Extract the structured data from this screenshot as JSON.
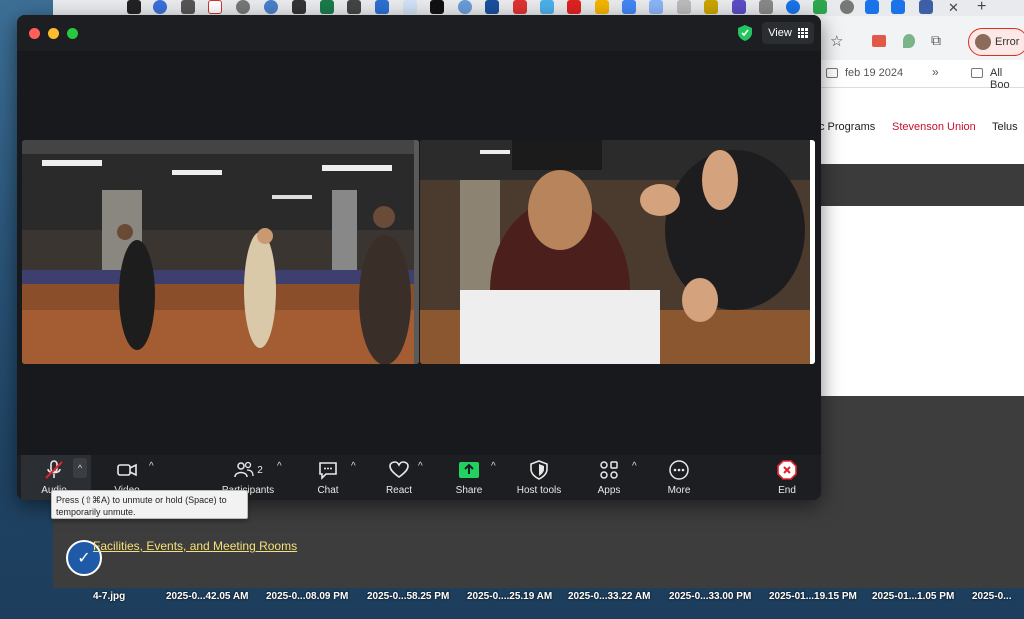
{
  "browser": {
    "bookmarks": {
      "folder_1": "feb 19 2024",
      "folder_2": "All Boo"
    },
    "profile_label": "Error",
    "site_nav": {
      "item_1": "c Programs",
      "item_2": "Stevenson Union",
      "item_3": "Telus"
    },
    "footer_link": "Facilities, Events, and Meeting Rooms",
    "colors": {
      "nav_red": "#c8102e",
      "link_yellow": "#f5e07a"
    }
  },
  "zoom": {
    "view_label": "View",
    "toolbar": {
      "audio": "Audio",
      "video": "Video",
      "participants": "Participants",
      "participants_count": "2",
      "chat": "Chat",
      "react": "React",
      "share": "Share",
      "host_tools": "Host tools",
      "apps": "Apps",
      "more": "More",
      "end": "End"
    },
    "tooltip": "Press (⇧⌘A) to unmute or hold (Space) to temporarily unmute.",
    "colors": {
      "share_green": "#23d160",
      "end_red": "#e0242c",
      "mute_red": "#e0242c"
    }
  },
  "desktop_files": [
    "4-7.jpg",
    "2025-0...42.05 AM",
    "2025-0...08.09 PM",
    "2025-0...58.25 PM",
    "2025-0....25.19 AM",
    "2025-0...33.22 AM",
    "2025-0...33.00 PM",
    "2025-01...19.15 PM",
    "2025-01...1.05 PM",
    "2025-0..."
  ]
}
